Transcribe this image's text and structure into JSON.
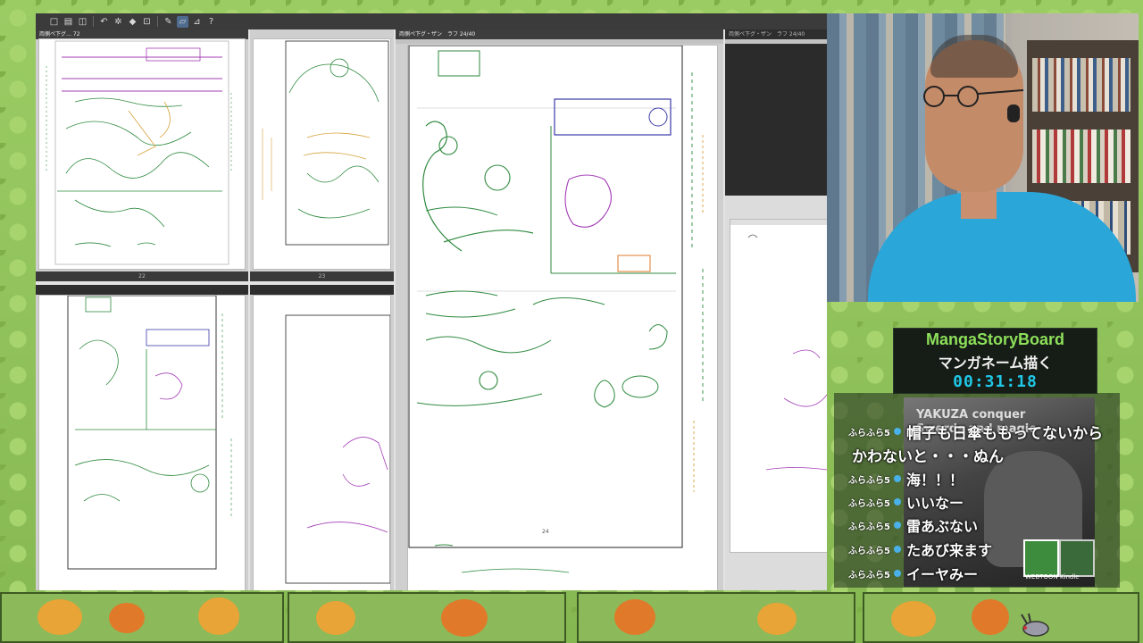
{
  "app": {
    "toolbar_icons": [
      "new-file-icon",
      "open-icon",
      "save-icon",
      "undo-icon",
      "gear-icon",
      "fill-icon",
      "transform-icon",
      "pen-icon",
      "eraser-icon",
      "ruler-icon",
      "help-icon"
    ],
    "tabs": {
      "left_top": "両側ペ下グ… 72",
      "center": "両側ペ下グ・ザン　ラフ 24/40",
      "right": "両側ペ下グ・ザン　ラフ 24/40"
    },
    "page_numbers": {
      "p22": "22",
      "p23": "23",
      "p24": "24"
    }
  },
  "overlay": {
    "title_en": "MangaStoryBoard",
    "title_jp": "マンガネーム描く",
    "timer": "00:31:18",
    "poster_text": "YAKUZA conquer\nSwords and magic",
    "badge_label": "WEBTOON Kindle"
  },
  "chat": [
    {
      "user": "ふらふら5",
      "message": "帽子も日傘ももってないから"
    },
    {
      "user": "",
      "message": "かわないと・・・ぬん"
    },
    {
      "user": "ふらふら5",
      "message": "海！！！"
    },
    {
      "user": "ふらふら5",
      "message": "いいなー"
    },
    {
      "user": "ふらふら5",
      "message": "雷あぶない"
    },
    {
      "user": "ふらふら5",
      "message": "たあび来ます"
    },
    {
      "user": "ふらふら5",
      "message": "イーヤみー"
    }
  ]
}
